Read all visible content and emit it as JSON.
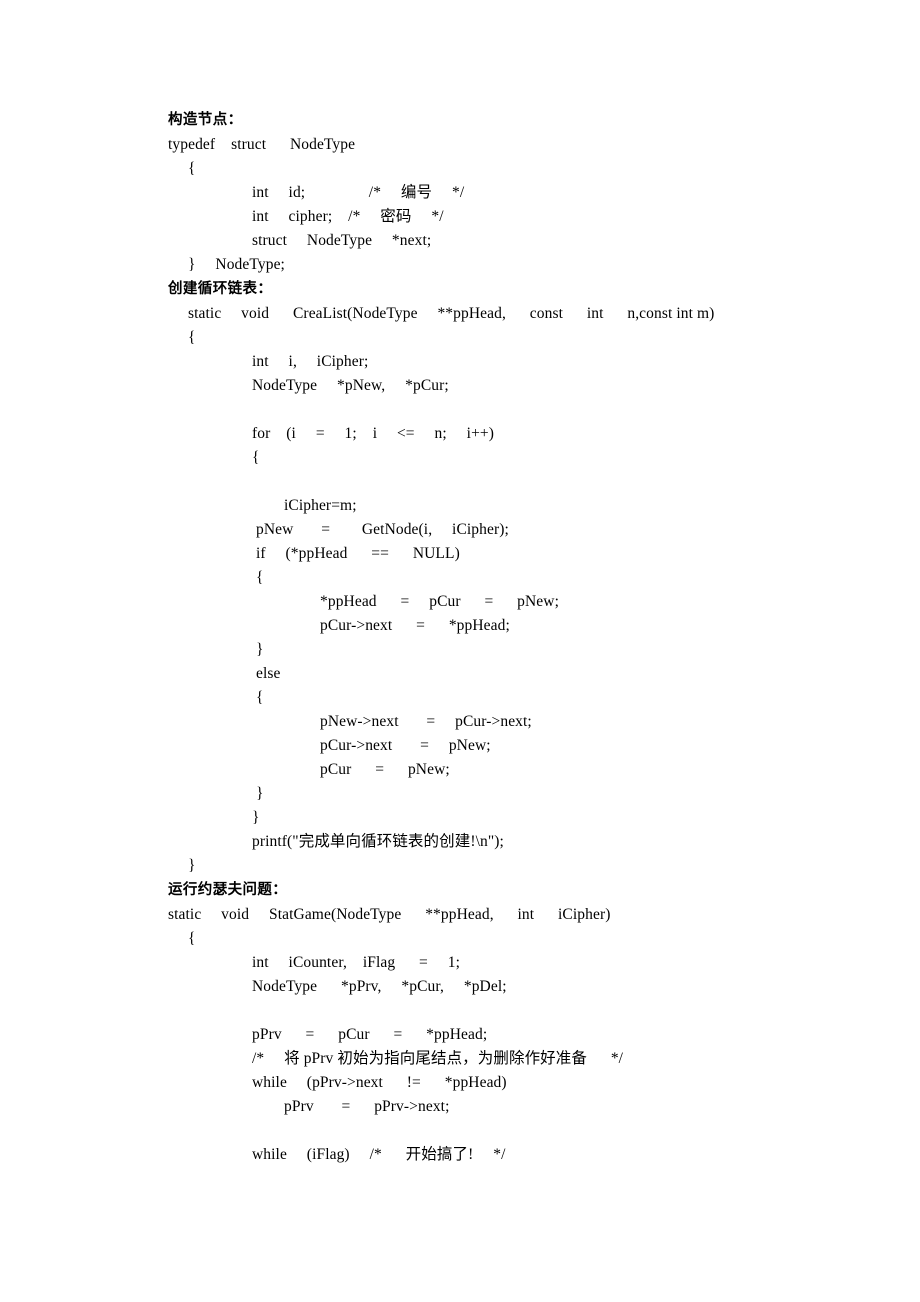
{
  "document": {
    "sections": [
      {
        "heading": "构造节点：",
        "lines": [
          {
            "indent": 0,
            "text": "typedef    struct      NodeType"
          },
          {
            "indent": 1,
            "text": "{"
          },
          {
            "indent": 2,
            "text": "int     id;                /*     编号     */"
          },
          {
            "indent": 2,
            "text": "int     cipher;    /*     密码     */"
          },
          {
            "indent": 2,
            "text": "struct     NodeType     *next;"
          },
          {
            "indent": 1,
            "text": "}     NodeType;"
          }
        ]
      },
      {
        "heading": "创建循环链表：",
        "lines": [
          {
            "indent": 1,
            "text": "static     void      CreaList(NodeType     **ppHead,      const      int      n,const int m)"
          },
          {
            "indent": 1,
            "text": "{"
          },
          {
            "indent": 2,
            "text": "int     i,     iCipher;"
          },
          {
            "indent": 2,
            "text": "NodeType     *pNew,     *pCur;"
          },
          {
            "indent": 0,
            "text": ""
          },
          {
            "indent": 2,
            "text": "for    (i     =     1;    i     <=     n;     i++)"
          },
          {
            "indent": 2,
            "text": "{"
          },
          {
            "indent": 0,
            "text": ""
          },
          {
            "indent": 4,
            "text": "iCipher=m;"
          },
          {
            "indent": 3,
            "text": "pNew       =        GetNode(i,     iCipher);"
          },
          {
            "indent": 3,
            "text": "if     (*ppHead      ==      NULL)"
          },
          {
            "indent": 3,
            "text": "{"
          },
          {
            "indent": 5,
            "text": "*ppHead      =     pCur      =      pNew;"
          },
          {
            "indent": 5,
            "text": "pCur->next      =      *ppHead;"
          },
          {
            "indent": 3,
            "text": "}"
          },
          {
            "indent": 3,
            "text": "else"
          },
          {
            "indent": 3,
            "text": "{"
          },
          {
            "indent": 5,
            "text": "pNew->next       =     pCur->next;"
          },
          {
            "indent": 5,
            "text": "pCur->next       =     pNew;"
          },
          {
            "indent": 5,
            "text": "pCur      =      pNew;"
          },
          {
            "indent": 3,
            "text": "}"
          },
          {
            "indent": 2,
            "text": "}"
          },
          {
            "indent": 2,
            "text": "printf(\"完成单向循环链表的创建!\\n\");"
          },
          {
            "indent": 1,
            "text": "}"
          }
        ]
      },
      {
        "heading": "运行约瑟夫问题：",
        "lines": [
          {
            "indent": 0,
            "text": "static     void     StatGame(NodeType      **ppHead,      int      iCipher)"
          },
          {
            "indent": 1,
            "text": "{"
          },
          {
            "indent": 2,
            "text": "int     iCounter,    iFlag      =     1;"
          },
          {
            "indent": 2,
            "text": "NodeType      *pPrv,     *pCur,     *pDel;"
          },
          {
            "indent": 0,
            "text": ""
          },
          {
            "indent": 2,
            "text": "pPrv      =      pCur      =      *ppHead;"
          },
          {
            "indent": 2,
            "text": "/*     将 pPrv 初始为指向尾结点，为删除作好准备      */"
          },
          {
            "indent": 2,
            "text": "while     (pPrv->next      !=      *ppHead)"
          },
          {
            "indent": 4,
            "text": "pPrv       =      pPrv->next;"
          },
          {
            "indent": 0,
            "text": ""
          },
          {
            "indent": 2,
            "text": "while     (iFlag)     /*      开始搞了!     */"
          }
        ]
      }
    ]
  }
}
